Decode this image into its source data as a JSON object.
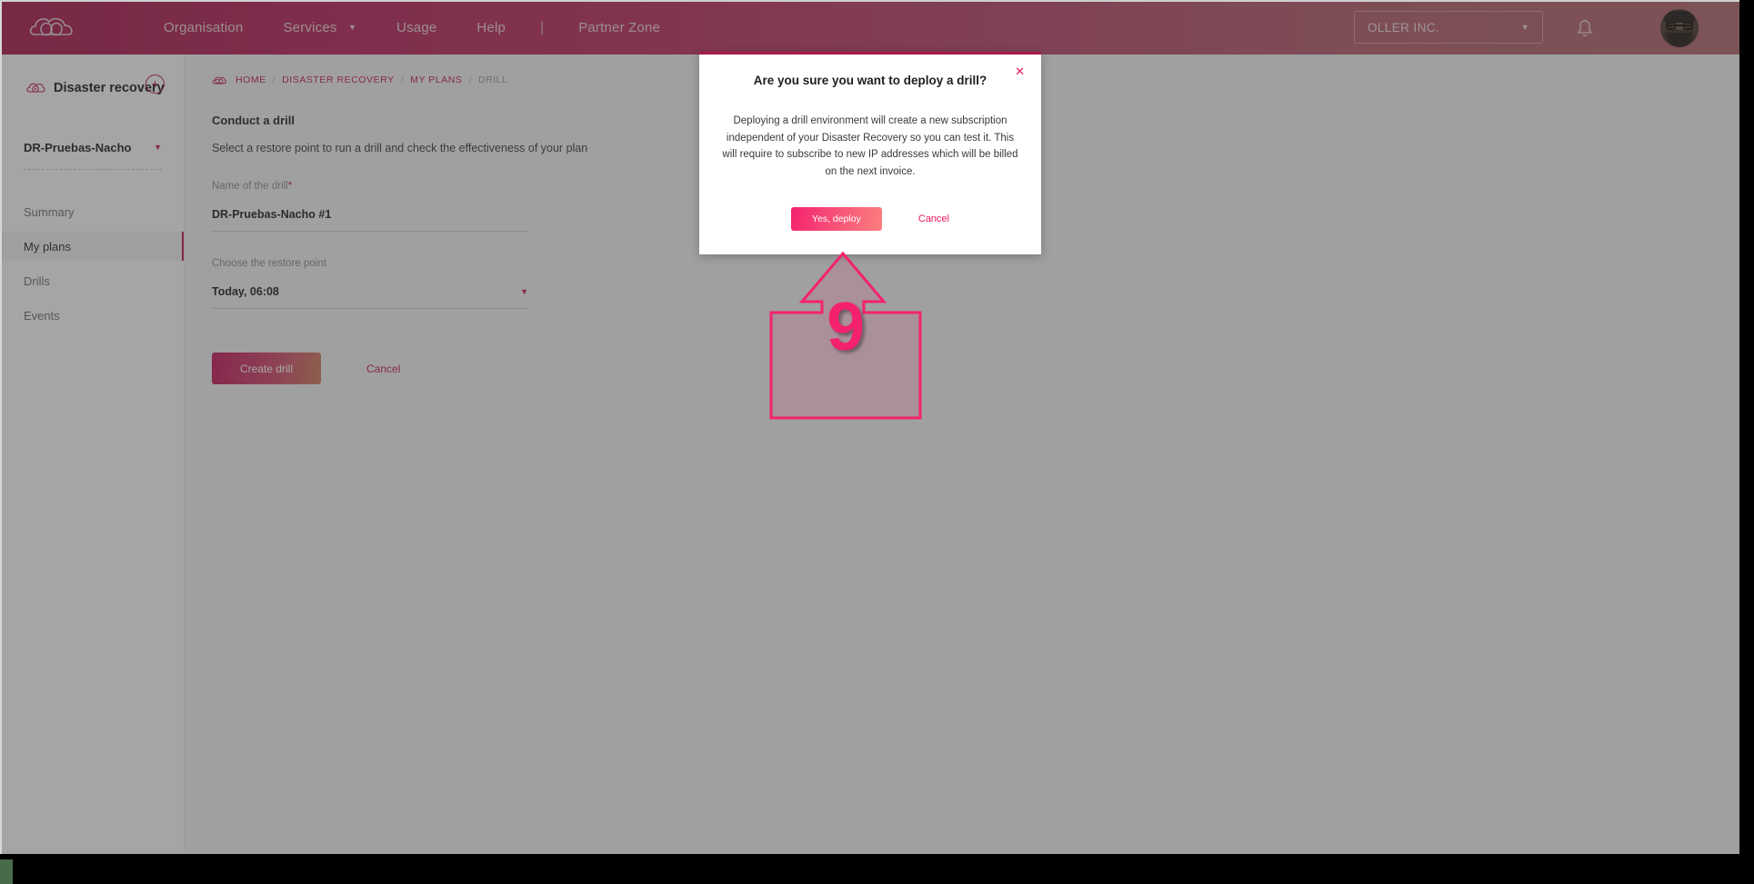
{
  "header": {
    "logo_icon": "cloud-logo-icon",
    "nav_items": [
      {
        "label": "Organisation",
        "has_caret": false
      },
      {
        "label": "Services",
        "has_caret": true
      },
      {
        "label": "Usage",
        "has_caret": false
      },
      {
        "label": "Help",
        "has_caret": false
      },
      {
        "label": "Partner Zone",
        "has_caret": false
      }
    ],
    "separator": "|",
    "org_selector": {
      "value": "OLLER INC."
    },
    "bell_icon": "notification-bell-icon",
    "avatar_icon": "user-avatar"
  },
  "sidebar": {
    "section_icon": "disaster-recovery-icon",
    "section_title": "Disaster recovery",
    "add_button": "+",
    "plan_selector": {
      "value": "DR-Pruebas-Nacho"
    },
    "items": [
      {
        "label": "Summary",
        "active": false
      },
      {
        "label": "My plans",
        "active": true
      },
      {
        "label": "Drills",
        "active": false
      },
      {
        "label": "Events",
        "active": false
      }
    ]
  },
  "breadcrumb": {
    "home_icon": "cloud-home-icon",
    "items": [
      "HOME",
      "DISASTER RECOVERY",
      "MY PLANS",
      "DRILL"
    ],
    "separator": "/"
  },
  "main": {
    "title": "Conduct a drill",
    "subtitle": "Select a restore point to run a drill and check the effectiveness of your plan",
    "name_field": {
      "label": "Name of the drill",
      "required_mark": "*",
      "value": "DR-Pruebas-Nacho #1"
    },
    "restore_point_field": {
      "label": "Choose the restore point",
      "value": "Today, 06:08",
      "caret": "▼"
    },
    "create_button": "Create drill",
    "cancel_link": "Cancel"
  },
  "modal": {
    "close_icon": "✕",
    "title": "Are you sure you want to deploy a drill?",
    "body": "Deploying a drill environment will create a new subscription independent of your Disaster Recovery so you can test it. This will require to subscribe to new IP addresses which will be billed on the next invoice.",
    "confirm_button": "Yes, deploy",
    "cancel_button": "Cancel"
  },
  "annotation": {
    "step_number": "9",
    "shape": "up-arrow-callout",
    "color": "#f4226e"
  },
  "colors": {
    "brand_magenta": "#c2185b",
    "header_gradient_start": "#a81a4e",
    "header_gradient_end": "#b1676c",
    "accent_pink": "#f4226e",
    "page_background": "#f2f2f2",
    "overlay": "rgba(60,60,60,0.45)"
  }
}
